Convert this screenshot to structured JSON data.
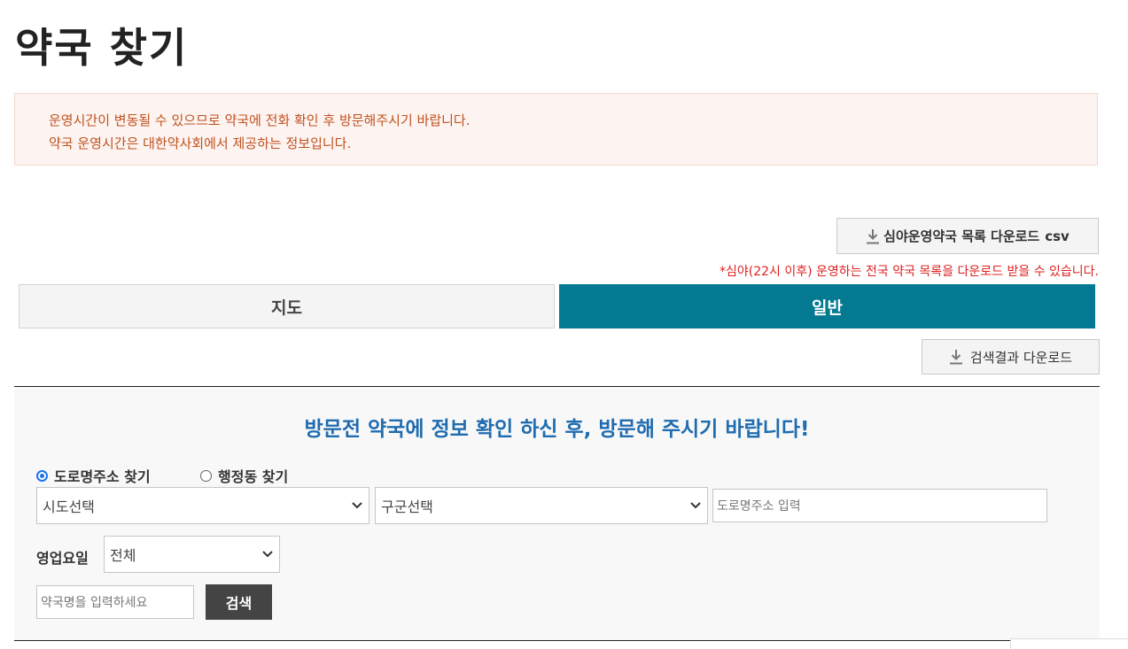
{
  "page": {
    "title": "약국 찾기"
  },
  "notice": {
    "line1": "운영시간이 변동될 수 있으므로 약국에 전화 확인 후 방문해주시기 바랍니다.",
    "line2": "약국 운영시간은 대한약사회에서 제공하는 정보입니다."
  },
  "download": {
    "night_label": "심야운영약국 목록 다운로드",
    "night_suffix": "csv",
    "night_note": "*심야(22시 이후) 운영하는 전국 약국 목록을 다운로드 받을 수 있습니다.",
    "results_label": "검색결과 다운로드",
    "icon": "download-icon"
  },
  "tabs": [
    {
      "label": "지도",
      "active": false
    },
    {
      "label": "일반",
      "active": true
    }
  ],
  "search": {
    "heading": "방문전 약국에 정보 확인 하신 후, 방문해 주시기 바랍니다!",
    "radio_road": {
      "label": "도로명주소 찾기",
      "checked": true
    },
    "radio_admin": {
      "label": "행정동 찾기",
      "checked": false
    },
    "sido_select": "시도선택",
    "gugun_select": "구군선택",
    "road_address_placeholder": "도로명주소 입력",
    "business_day_label": "영업요일",
    "business_day_value": "전체",
    "pharmacy_name_placeholder": "약국명을 입력하세요",
    "search_button": "검색"
  },
  "colors": {
    "accent": "#037a92",
    "heading": "#1f6cb0",
    "notice_text": "#c0521f",
    "notice_bg": "#fdf3f0",
    "warning": "#e02020"
  }
}
